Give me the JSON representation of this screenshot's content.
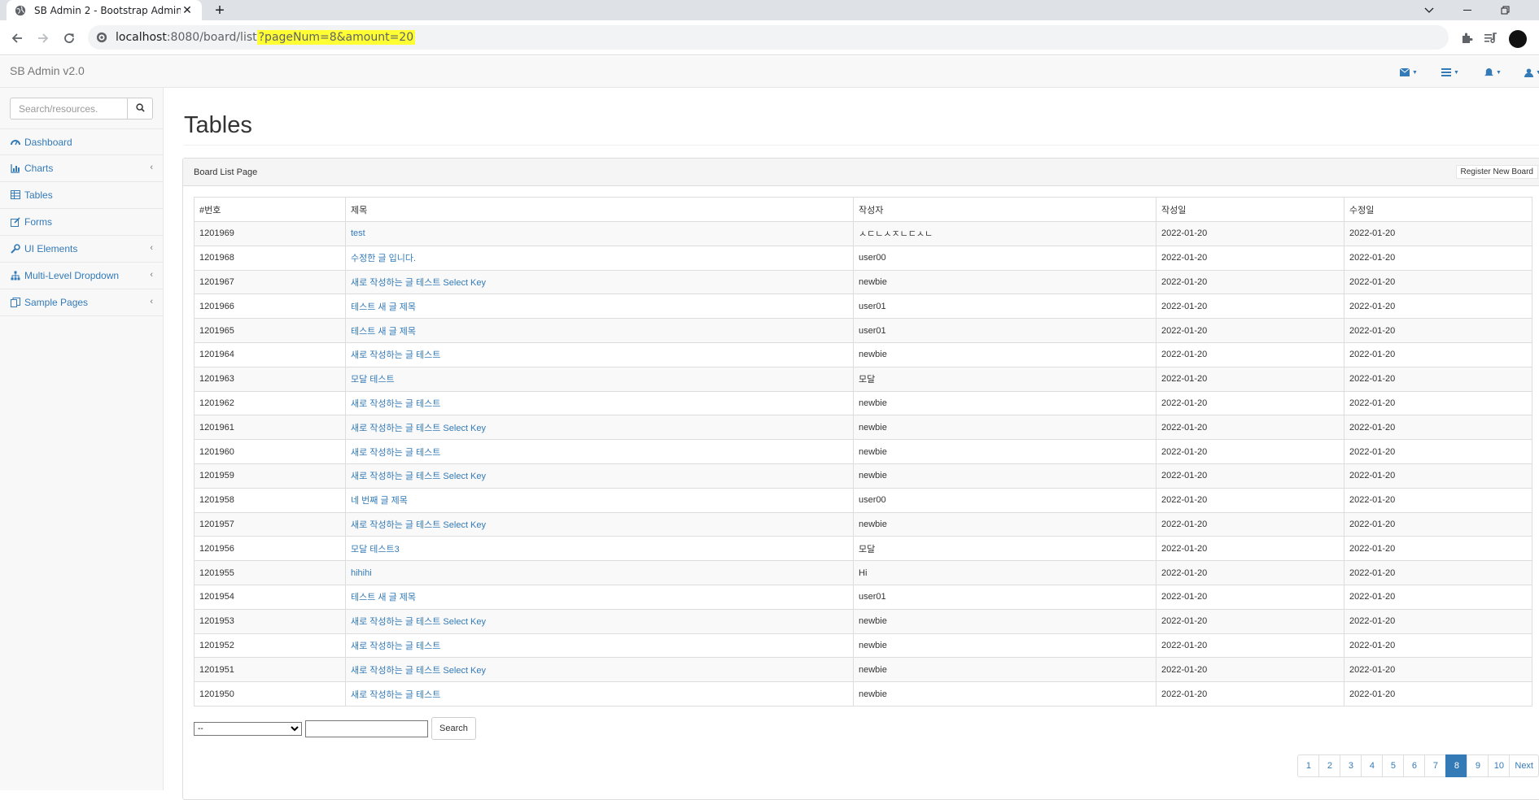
{
  "browser": {
    "tab_title": "SB Admin 2 - Bootstrap Admin",
    "url_host": "localhost",
    "url_path": ":8080/board/list",
    "url_query": "?pageNum=8&amount=20"
  },
  "app": {
    "brand": "SB Admin v2.0"
  },
  "sidebar": {
    "search_placeholder": "Search/resources.",
    "items": [
      {
        "label": "Dashboard",
        "icon": "dashboard-icon",
        "has_arrow": false
      },
      {
        "label": "Charts",
        "icon": "bar-chart-icon",
        "has_arrow": true
      },
      {
        "label": "Tables",
        "icon": "table-icon",
        "has_arrow": false
      },
      {
        "label": "Forms",
        "icon": "edit-icon",
        "has_arrow": false
      },
      {
        "label": "UI Elements",
        "icon": "wrench-icon",
        "has_arrow": true
      },
      {
        "label": "Multi-Level Dropdown",
        "icon": "sitemap-icon",
        "has_arrow": true
      },
      {
        "label": "Sample Pages",
        "icon": "files-icon",
        "has_arrow": true
      }
    ],
    "arrow": "‹"
  },
  "main": {
    "title": "Tables",
    "panel_heading": "Board List Page",
    "register_button": "Register New Board",
    "columns": [
      "#번호",
      "제목",
      "작성자",
      "작성일",
      "수정일"
    ],
    "rows": [
      {
        "bno": "1201969",
        "title": "test",
        "writer": "ㅅㄷㄴㅅㅈㄴㄷㅅㄴ",
        "regdate": "2022-01-20",
        "updatedate": "2022-01-20"
      },
      {
        "bno": "1201968",
        "title": "수정한 글 입니다.",
        "writer": "user00",
        "regdate": "2022-01-20",
        "updatedate": "2022-01-20"
      },
      {
        "bno": "1201967",
        "title": "새로 작성하는 글 테스트 Select Key",
        "writer": "newbie",
        "regdate": "2022-01-20",
        "updatedate": "2022-01-20"
      },
      {
        "bno": "1201966",
        "title": "테스트 새 글 제목",
        "writer": "user01",
        "regdate": "2022-01-20",
        "updatedate": "2022-01-20"
      },
      {
        "bno": "1201965",
        "title": "테스트 새 글 제목",
        "writer": "user01",
        "regdate": "2022-01-20",
        "updatedate": "2022-01-20"
      },
      {
        "bno": "1201964",
        "title": "새로 작성하는 글 테스트",
        "writer": "newbie",
        "regdate": "2022-01-20",
        "updatedate": "2022-01-20"
      },
      {
        "bno": "1201963",
        "title": "모달 테스트",
        "writer": "모달",
        "regdate": "2022-01-20",
        "updatedate": "2022-01-20"
      },
      {
        "bno": "1201962",
        "title": "새로 작성하는 글 테스트",
        "writer": "newbie",
        "regdate": "2022-01-20",
        "updatedate": "2022-01-20"
      },
      {
        "bno": "1201961",
        "title": "새로 작성하는 글 테스트 Select Key",
        "writer": "newbie",
        "regdate": "2022-01-20",
        "updatedate": "2022-01-20"
      },
      {
        "bno": "1201960",
        "title": "새로 작성하는 글 테스트",
        "writer": "newbie",
        "regdate": "2022-01-20",
        "updatedate": "2022-01-20"
      },
      {
        "bno": "1201959",
        "title": "새로 작성하는 글 테스트 Select Key",
        "writer": "newbie",
        "regdate": "2022-01-20",
        "updatedate": "2022-01-20"
      },
      {
        "bno": "1201958",
        "title": "네 번째 글 제목",
        "writer": "user00",
        "regdate": "2022-01-20",
        "updatedate": "2022-01-20"
      },
      {
        "bno": "1201957",
        "title": "새로 작성하는 글 테스트 Select Key",
        "writer": "newbie",
        "regdate": "2022-01-20",
        "updatedate": "2022-01-20"
      },
      {
        "bno": "1201956",
        "title": "모달 테스트3",
        "writer": "모달",
        "regdate": "2022-01-20",
        "updatedate": "2022-01-20"
      },
      {
        "bno": "1201955",
        "title": "hihihi",
        "writer": "Hi",
        "regdate": "2022-01-20",
        "updatedate": "2022-01-20"
      },
      {
        "bno": "1201954",
        "title": "테스트 새 글 제목",
        "writer": "user01",
        "regdate": "2022-01-20",
        "updatedate": "2022-01-20"
      },
      {
        "bno": "1201953",
        "title": "새로 작성하는 글 테스트 Select Key",
        "writer": "newbie",
        "regdate": "2022-01-20",
        "updatedate": "2022-01-20"
      },
      {
        "bno": "1201952",
        "title": "새로 작성하는 글 테스트",
        "writer": "newbie",
        "regdate": "2022-01-20",
        "updatedate": "2022-01-20"
      },
      {
        "bno": "1201951",
        "title": "새로 작성하는 글 테스트 Select Key",
        "writer": "newbie",
        "regdate": "2022-01-20",
        "updatedate": "2022-01-20"
      },
      {
        "bno": "1201950",
        "title": "새로 작성하는 글 테스트",
        "writer": "newbie",
        "regdate": "2022-01-20",
        "updatedate": "2022-01-20"
      }
    ],
    "search": {
      "type_selected": "--",
      "keyword_value": "",
      "button_label": "Search"
    },
    "pagination": {
      "pages": [
        "1",
        "2",
        "3",
        "4",
        "5",
        "6",
        "7",
        "8",
        "9",
        "10"
      ],
      "active": "8",
      "next_label": "Next"
    }
  },
  "colors": {
    "link": "#337ab7",
    "url_highlight": "#ffff33",
    "active_page": "#337ab7"
  }
}
